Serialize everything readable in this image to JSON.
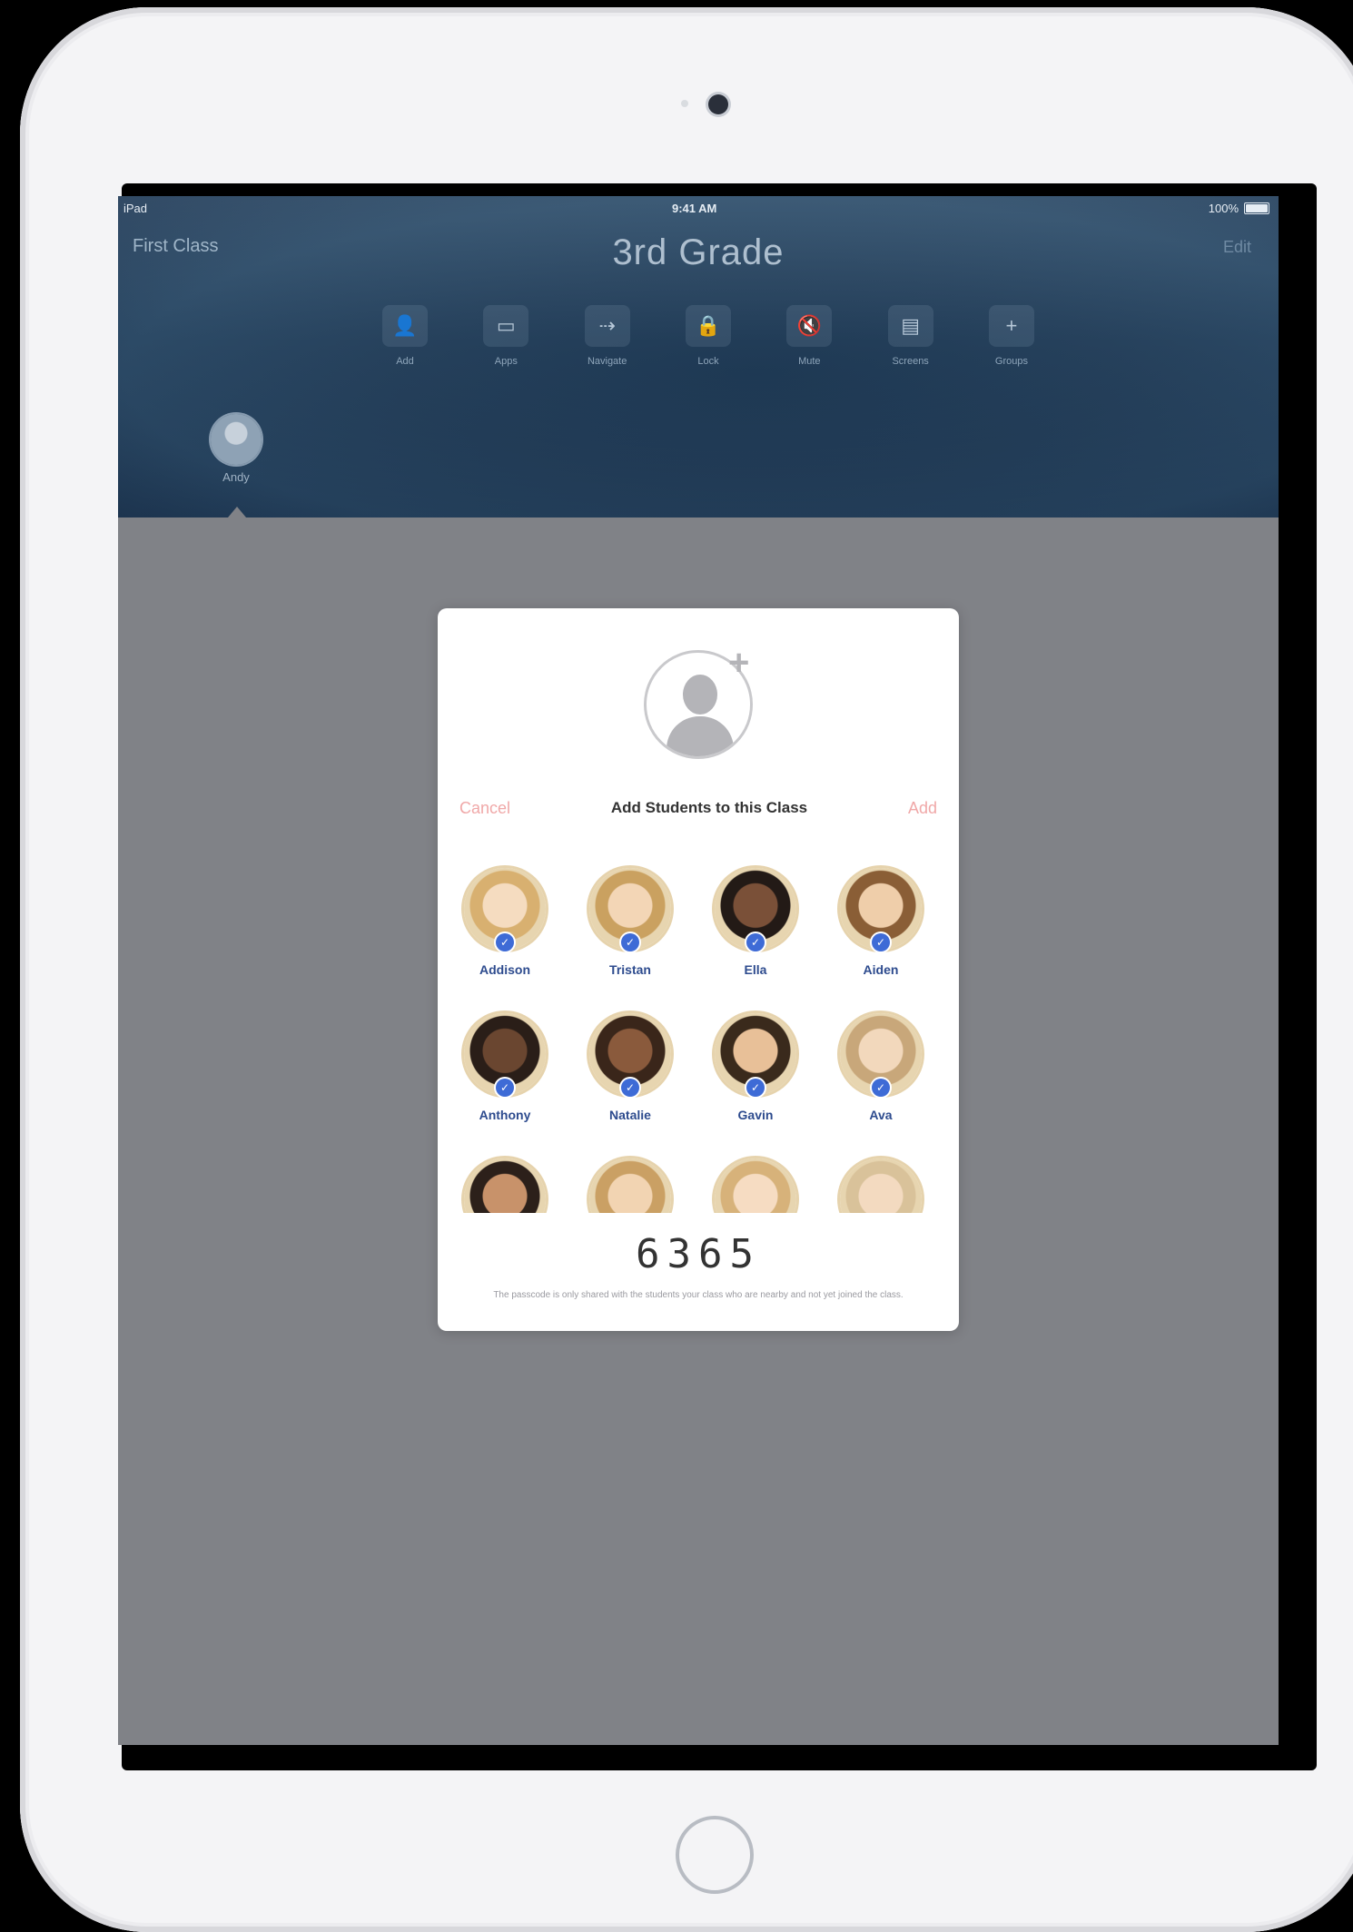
{
  "status_bar": {
    "carrier": "iPad",
    "time": "9:41 AM",
    "battery_text": "100%",
    "battery_level": 1.0
  },
  "nav": {
    "back_label": "First Class",
    "title": "3rd Grade",
    "right_label": "Edit"
  },
  "toolbar": [
    {
      "icon": "person-icon",
      "glyph": "👤",
      "label": "Add"
    },
    {
      "icon": "apps-icon",
      "glyph": "▭",
      "label": "Apps"
    },
    {
      "icon": "navigate-icon",
      "glyph": "⇢",
      "label": "Navigate"
    },
    {
      "icon": "lock-icon",
      "glyph": "🔒",
      "label": "Lock"
    },
    {
      "icon": "mute-icon",
      "glyph": "🔇",
      "label": "Mute"
    },
    {
      "icon": "screen-icon",
      "glyph": "▤",
      "label": "Screens"
    },
    {
      "icon": "plus-icon",
      "glyph": "+",
      "label": "Groups"
    }
  ],
  "student_tab": {
    "label": "Andy"
  },
  "dialog": {
    "cancel_label": "Cancel",
    "title": "Add Students to this Class",
    "add_label": "Add",
    "code": "6365",
    "fine_print": "The passcode is only shared with the students your class who are nearby and not yet joined the class."
  },
  "students": [
    {
      "name": "Addison",
      "face": "#f5dcc0",
      "hair": "#d8b070",
      "selected": true
    },
    {
      "name": "Tristan",
      "face": "#f3d6b6",
      "hair": "#caa160",
      "selected": true
    },
    {
      "name": "Ella",
      "face": "#7a5038",
      "hair": "#231a16",
      "selected": true
    },
    {
      "name": "Aiden",
      "face": "#efceaa",
      "hair": "#8a5e36",
      "selected": true
    },
    {
      "name": "Anthony",
      "face": "#6a4630",
      "hair": "#2a1e18",
      "selected": true
    },
    {
      "name": "Natalie",
      "face": "#8a5a3c",
      "hair": "#3a261a",
      "selected": true
    },
    {
      "name": "Gavin",
      "face": "#e8c098",
      "hair": "#3a2a1c",
      "selected": true
    },
    {
      "name": "Ava",
      "face": "#f2d8bc",
      "hair": "#c8a77a",
      "selected": true
    },
    {
      "name": "",
      "face": "#c8926a",
      "hair": "#2c201a",
      "selected": false
    },
    {
      "name": "",
      "face": "#f2d4b2",
      "hair": "#caa064",
      "selected": false
    },
    {
      "name": "",
      "face": "#f6dcc2",
      "hair": "#d7b27a",
      "selected": false
    },
    {
      "name": "",
      "face": "#f3dac0",
      "hair": "#d9c29a",
      "selected": false
    }
  ],
  "colors": {
    "nav_background": "#26415c",
    "screen_dim": "#808287",
    "accent_red": "#f0a8a8",
    "check_blue": "#3e6bd6",
    "name_blue": "#2d4b8e"
  }
}
